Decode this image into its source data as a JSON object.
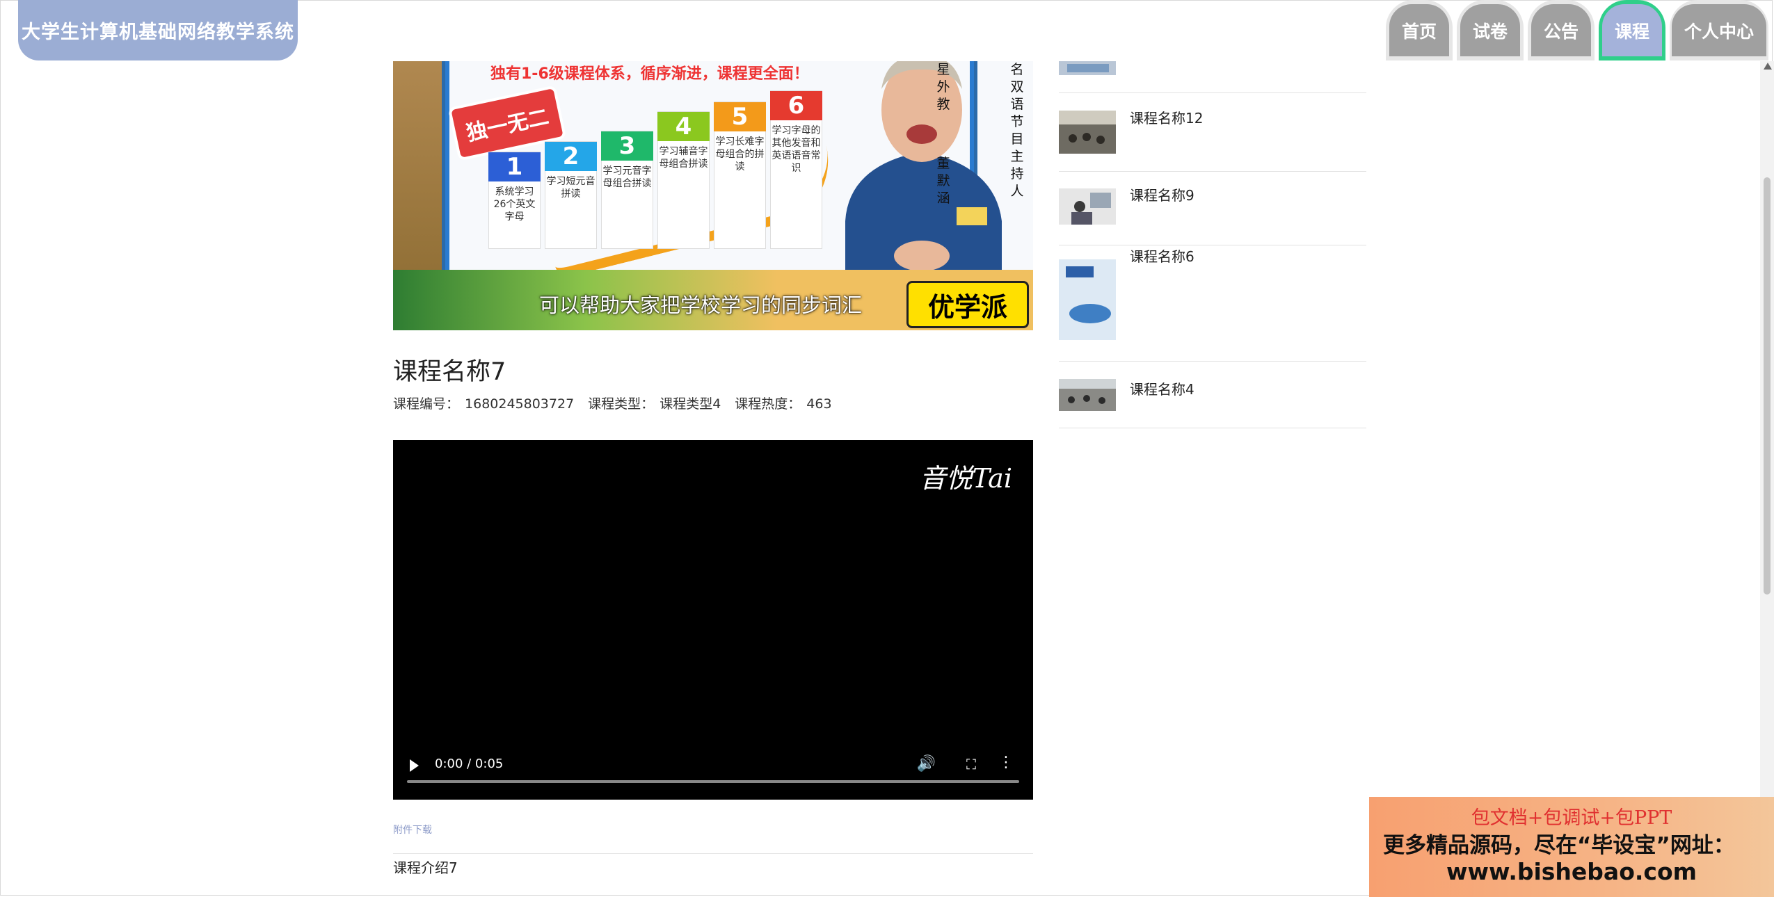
{
  "header": {
    "title": "大学生计算机基础网络教学系统",
    "nav": [
      {
        "label": "首页",
        "active": false
      },
      {
        "label": "试卷",
        "active": false
      },
      {
        "label": "公告",
        "active": false
      },
      {
        "label": "课程",
        "active": true
      },
      {
        "label": "个人中心",
        "active": false
      }
    ]
  },
  "banner": {
    "slogan": "独有1-6级课程体系，循序渐进，课程更全面！",
    "badge": "独一无二",
    "steps": [
      {
        "num": "1",
        "text": "系统学习26个英文字母"
      },
      {
        "num": "2",
        "text": "学习短元音拼读"
      },
      {
        "num": "3",
        "text": "学习元音字母组合拼读"
      },
      {
        "num": "4",
        "text": "学习辅音字母组合拼读"
      },
      {
        "num": "5",
        "text": "学习长难字母组合的拼读"
      },
      {
        "num": "6",
        "text": "学习字母的其他发音和英语语音常识"
      }
    ],
    "side_text_1": "星外教",
    "side_text_2": "董默涵",
    "side_text_3": "名双语节目主持人",
    "caption": "可以帮助大家把学校学习的同步词汇",
    "brand": "优学派"
  },
  "course": {
    "title": "课程名称7",
    "meta": [
      {
        "label": "课程编号：",
        "value": "1680245803727"
      },
      {
        "label": "课程类型：",
        "value": "课程类型4"
      },
      {
        "label": "课程热度：",
        "value": "463"
      }
    ]
  },
  "video": {
    "watermark": "音悦Tai",
    "time": "0:00 / 0:05",
    "volume_icon": "volume-icon",
    "fullscreen_icon": "fullscreen-icon",
    "more_icon": "more-vert-icon"
  },
  "attachment_label": "附件下载",
  "intro": "课程介绍7",
  "sidebar": {
    "items": [
      {
        "name": ""
      },
      {
        "name": "课程名称12"
      },
      {
        "name": "课程名称9"
      },
      {
        "name": "课程名称6"
      },
      {
        "name": "课程名称4"
      }
    ]
  },
  "ad": {
    "line1": "包文档+包调试+包PPT",
    "line2": "更多精品源码，尽在“毕设宝”网址：",
    "line3": "www.bishebao.com"
  }
}
